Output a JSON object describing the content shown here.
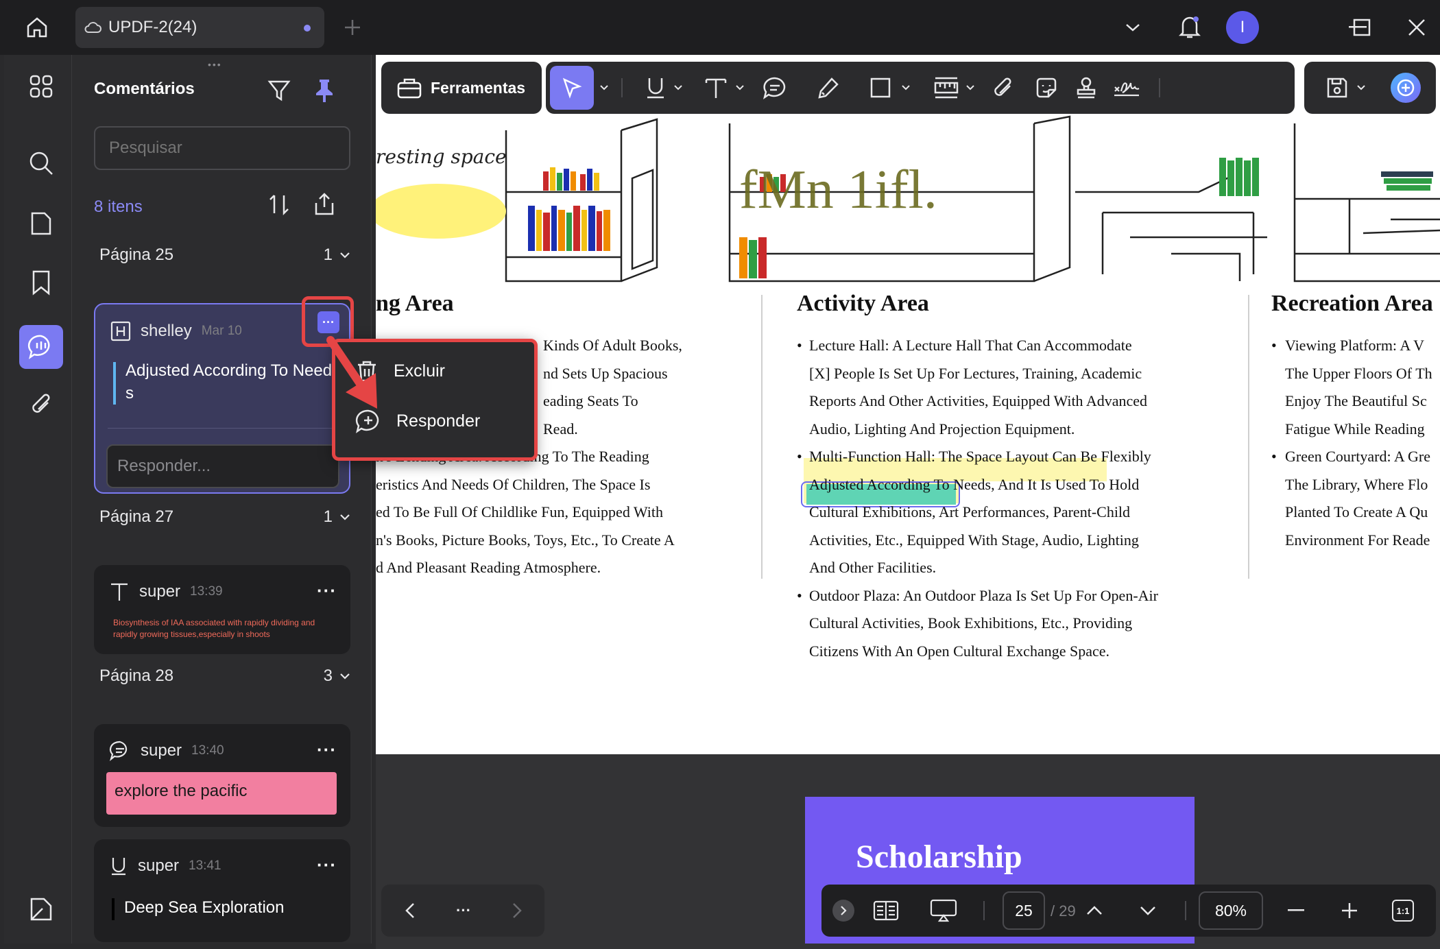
{
  "window": {
    "tab_title": "UPDF-2(24)"
  },
  "sidebar": {
    "title": "Comentários",
    "search_placeholder": "Pesquisar",
    "item_count": "8 itens",
    "pages": [
      {
        "label": "Página 25",
        "count": "1"
      },
      {
        "label": "Página 27",
        "count": "1"
      },
      {
        "label": "Página 28",
        "count": "3"
      }
    ],
    "comments": [
      {
        "author": "shelley",
        "time": "Mar 10",
        "text_line1": "Adjusted According To Need",
        "text_line2": "s",
        "reply_placeholder": "Responder..."
      },
      {
        "author": "super",
        "time": "13:39",
        "text_line1": "Biosynthesis of IAA associated with rapidly dividing and",
        "text_line2": "rapidly growing tissues,especially in shoots"
      },
      {
        "author": "super",
        "time": "13:40",
        "text": "explore the pacific"
      },
      {
        "author": "super",
        "time": "13:41",
        "text": "Deep Sea Exploration"
      }
    ],
    "more_label": "···"
  },
  "context_menu": {
    "delete_label": "Excluir",
    "reply_label": "Responder"
  },
  "toolbar": {
    "tools_label": "Ferramentas"
  },
  "document": {
    "image_caption": "resting space",
    "image_garbled": "fMn 1ifl.",
    "col1": {
      "heading": "ng Area",
      "lines": [
        "Kinds Of Adult Books,",
        "nd Sets Up Spacious",
        "eading Seats To",
        "Read.",
        "n's Lending Area: According To The Reading",
        "eristics And Needs Of Children, The Space Is",
        "ed To Be Full Of Childlike Fun, Equipped With",
        "n's Books, Picture Books, Toys, Etc., To Create A",
        "d And Pleasant Reading Atmosphere."
      ]
    },
    "col2": {
      "heading": "Activity Area",
      "lines": [
        "Lecture Hall: A Lecture Hall That Can Accommodate",
        "[X] People Is Set Up For Lectures, Training, Academic",
        "Reports And Other Activities, Equipped With Advanced",
        "Audio, Lighting And Projection Equipment.",
        "Multi-Function Hall: The Space Layout Can Be Flexibly",
        "Adjusted According To Needs",
        ", And It Is Used To Hold",
        "Cultural Exhibitions, Art Performances, Parent-Child",
        "Activities, Etc., Equipped With Stage, Audio, Lighting",
        "And Other Facilities.",
        "Outdoor Plaza: An Outdoor Plaza Is Set Up For Open-Air",
        "Cultural Activities, Book Exhibitions, Etc., Providing",
        "Citizens With An Open Cultural Exchange Space."
      ]
    },
    "col3": {
      "heading": "Recreation Area",
      "lines": [
        "Viewing Platform: A V",
        "The Upper Floors Of Th",
        "Enjoy The Beautiful Sc",
        "Fatigue While Reading",
        "Green Courtyard: A Gre",
        "The Library, Where Flo",
        "Planted To Create A Qu",
        "Environment For Reade"
      ]
    },
    "next_page_title": "Scholarship",
    "bullet": "•"
  },
  "bottom_bar": {
    "current_page": "25",
    "total_pages": "/ 29",
    "zoom": "80%",
    "fit_label": "1:1",
    "nav_more": "···"
  },
  "colors": {
    "accent": "#7b7af2",
    "highlight_yellow": "#fdf7b0",
    "highlight_green": "#5fd4b4",
    "red_annotation": "#e54545",
    "pink_note": "#f27fa0",
    "scholarship_bg": "#7359f2"
  },
  "user": {
    "avatar_letter": "I"
  }
}
